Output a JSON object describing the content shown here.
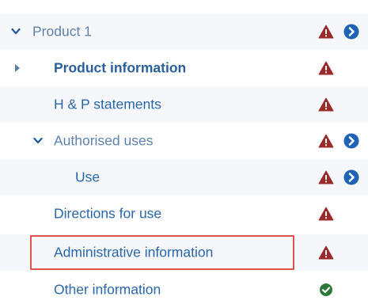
{
  "tree": {
    "items": [
      {
        "label": "Product 1",
        "expanded": true,
        "status": "warning",
        "has_navigate": true
      },
      {
        "label": "Product information",
        "selected": true,
        "status": "warning"
      },
      {
        "label": "H & P statements",
        "status": "warning"
      },
      {
        "label": "Authorised uses",
        "expanded": true,
        "status": "warning",
        "has_navigate": true
      },
      {
        "label": "Use",
        "status": "warning",
        "has_navigate": true
      },
      {
        "label": "Directions for use",
        "status": "warning"
      },
      {
        "label": "Administrative information",
        "status": "warning",
        "highlighted": true
      },
      {
        "label": "Other information",
        "status": "ok"
      }
    ]
  },
  "icons": {
    "warning": "warning-triangle-icon",
    "navigate": "chevron-right-circle-icon",
    "ok": "check-circle-icon",
    "expand": "chevron-down-icon",
    "collapsed": "caret-right-icon"
  },
  "colors": {
    "link": "#2a67ad",
    "warning": "#9b2b2b",
    "navigate": "#1e63b8",
    "ok": "#2c7a3b",
    "highlight_border": "#e0534a"
  }
}
